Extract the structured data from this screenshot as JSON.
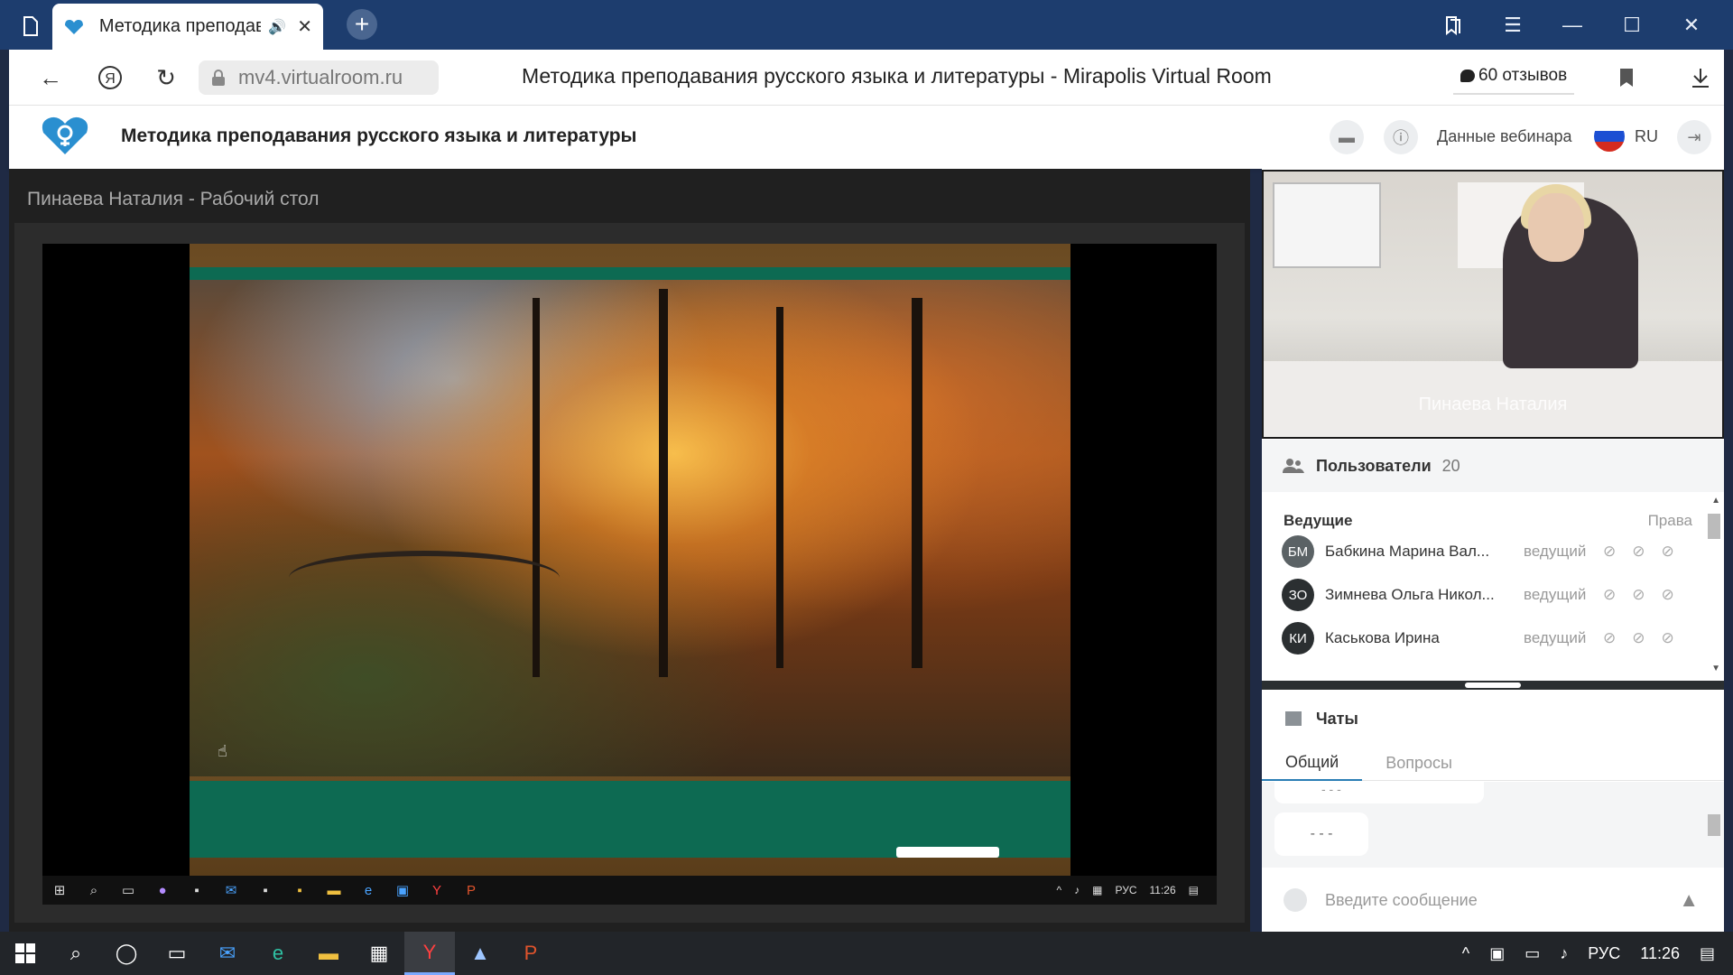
{
  "browser": {
    "tab_title": "Методика преподав",
    "url": "mv4.virtualroom.ru",
    "page_title": "Методика преподавания русского языка и литературы - Mirapolis Virtual Room",
    "reviews": "60 отзывов"
  },
  "app": {
    "title": "Методика преподавания русского языка и литературы",
    "webinar_data": "Данные вебинара",
    "language": "RU"
  },
  "stage": {
    "title": "Пинаева Наталия - Рабочий стол",
    "inner_tray_lang": "РУС",
    "inner_tray_time": "11:26"
  },
  "camera": {
    "name": "Пинаева Наталия"
  },
  "users": {
    "title": "Пользователи",
    "count": "20",
    "hosts_title": "Ведущие",
    "rights_label": "Права",
    "list": [
      {
        "initials": "БМ",
        "name": "Бабкина Марина Вал...",
        "role": "ведущий"
      },
      {
        "initials": "ЗО",
        "name": "Зимнева Ольга Никол...",
        "role": "ведущий"
      },
      {
        "initials": "КИ",
        "name": "Каськова Ирина",
        "role": "ведущий"
      }
    ]
  },
  "chats": {
    "title": "Чаты",
    "tabs": [
      "Общий",
      "Вопросы"
    ],
    "messages": [
      "- - -",
      "- - -"
    ],
    "input_placeholder": "Введите сообщение"
  },
  "taskbar": {
    "lang": "РУС",
    "time": "11:26"
  },
  "colors": {
    "tabstrip": "#1d3d6e",
    "taskbar": "#222529",
    "accent": "#2a7db5",
    "slide_green": "#0d6a52"
  }
}
